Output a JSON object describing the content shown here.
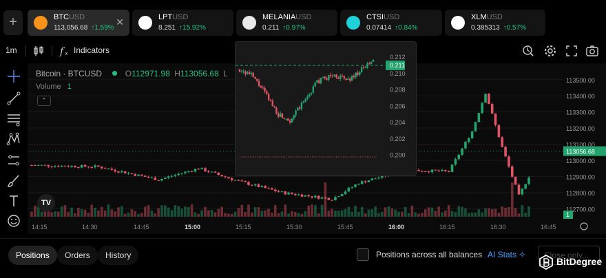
{
  "tickers": [
    {
      "base": "BTC",
      "quote": "USD",
      "price": "113,056.68",
      "change": "↑1.59%",
      "icon": "bitcoin-icon",
      "color": "#f7931a",
      "active": true
    },
    {
      "base": "LPT",
      "quote": "USD",
      "price": "8.251",
      "change": "↑15.92%",
      "icon": "livepeer-icon",
      "color": "#ffffff",
      "active": false
    },
    {
      "base": "MELANIA",
      "quote": "USD",
      "price": "0.211",
      "change": "↑0.97%",
      "icon": "melania-icon",
      "color": "#e8e8e8",
      "active": false
    },
    {
      "base": "CTSI",
      "quote": "USD",
      "price": "0.07414",
      "change": "↑0.84%",
      "icon": "cartesi-icon",
      "color": "#1fd1d9",
      "active": false
    },
    {
      "base": "XLM",
      "quote": "USD",
      "price": "0.385313",
      "change": "↑0.57%",
      "icon": "stellar-icon",
      "color": "#ffffff",
      "active": false
    }
  ],
  "toolbar": {
    "interval": "1m",
    "indicators": "Indicators"
  },
  "legend": {
    "symbol": "Bitcoin · BTCUSD",
    "o_label": "O",
    "o_value": "112971.98",
    "h_label": "H",
    "h_value": "113056.68",
    "l_label": "L"
  },
  "volume": {
    "label": "Volume",
    "value": "1"
  },
  "tv_logo": "TV",
  "chart_data": [
    {
      "type": "candlestick",
      "symbol": "BTCUSD",
      "ylim": [
        112650,
        113580
      ],
      "y_ticks": [
        "113500.00",
        "113400.00",
        "113300.00",
        "113200.00",
        "113100.00",
        "113000.00",
        "112900.00",
        "112800.00",
        "112700.00"
      ],
      "x_ticks": [
        "14:15",
        "14:30",
        "14:45",
        "15:00",
        "15:15",
        "15:30",
        "15:45",
        "16:00",
        "16:15",
        "16:30",
        "16:45"
      ],
      "bold_x_ticks": [
        "15:00",
        "16:00"
      ],
      "current_price": "113056.68",
      "volume_badge": "1",
      "colors": {
        "up": "#25a36f",
        "down": "#e05565"
      }
    },
    {
      "type": "candlestick",
      "symbol": "MELANIAUSD",
      "ylim": [
        0.1992,
        0.2126
      ],
      "y_ticks": [
        "0.212",
        "0.210",
        "0.208",
        "0.206",
        "0.204",
        "0.202",
        "0.200"
      ],
      "current_price": "0.211",
      "colors": {
        "up": "#25a36f",
        "down": "#e05565"
      }
    }
  ],
  "bottom": {
    "tabs": [
      "Positions",
      "Orders",
      "History"
    ],
    "checkbox_label": "Positions across all balances",
    "ai_stats": "AI Stats",
    "close_only": "Close only..."
  },
  "watermark": "BitDegree"
}
